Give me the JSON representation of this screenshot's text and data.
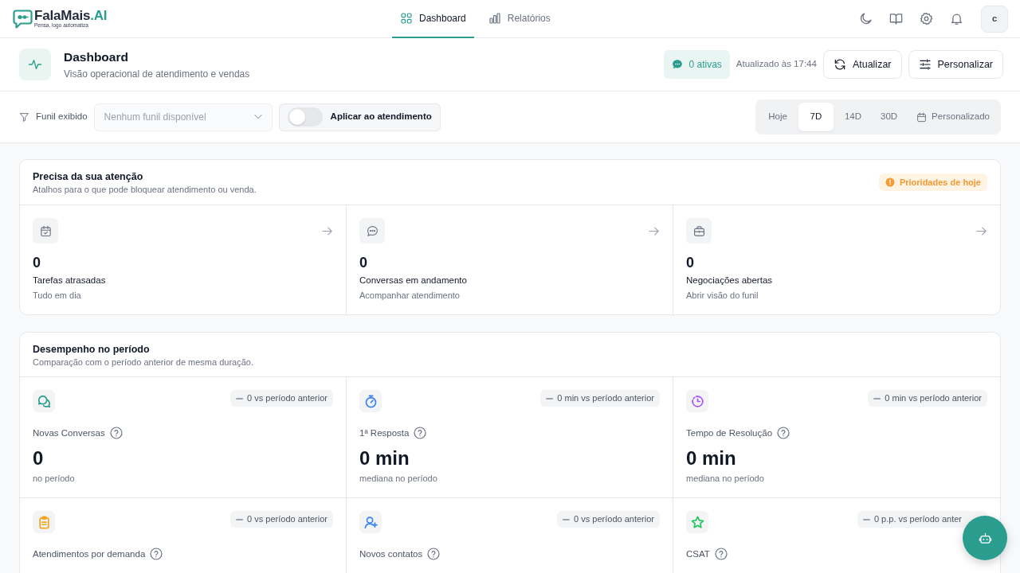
{
  "brand": {
    "name": "FalaMais",
    "suffix": ".AI",
    "tagline": "Pensa, logo automatiza"
  },
  "nav_tabs": [
    {
      "label": "Dashboard",
      "selected": true
    },
    {
      "label": "Relatórios",
      "selected": false
    }
  ],
  "user": {
    "initial": "c"
  },
  "page_header": {
    "title": "Dashboard",
    "subtitle": "Visão operacional de atendimento e vendas",
    "active_badge": "0 ativas",
    "updated": "Atualizado às 17:44",
    "buttons": [
      "Atualizar",
      "Personalizar"
    ]
  },
  "filters": {
    "funnel_label": "Funil exibido",
    "funnel_select": {
      "placeholder": "Nenhum funil disponível"
    },
    "apply_toggle": {
      "label": "Aplicar ao atendimento",
      "on": false
    },
    "periods": [
      {
        "label": "Hoje",
        "selected": false,
        "kind": "preset"
      },
      {
        "label": "7D",
        "selected": true,
        "kind": "preset"
      },
      {
        "label": "14D",
        "selected": false,
        "kind": "preset"
      },
      {
        "label": "30D",
        "selected": false,
        "kind": "preset"
      },
      {
        "label": "Personalizado",
        "selected": false,
        "kind": "custom"
      }
    ]
  },
  "attention": {
    "title": "Precisa da sua atenção",
    "subtitle": "Atalhos para o que pode bloquear atendimento ou venda.",
    "badge": "Prioridades de hoje",
    "items": [
      {
        "count": "0",
        "label": "Tarefas atrasadas",
        "hint": "Tudo em dia"
      },
      {
        "count": "0",
        "label": "Conversas em andamento",
        "hint": "Acompanhar atendimento"
      },
      {
        "count": "0",
        "label": "Negociações abertas",
        "hint": "Abrir visão do funil"
      }
    ]
  },
  "performance": {
    "title": "Desempenho no período",
    "subtitle": "Comparação com o período anterior de mesma duração.",
    "metrics": [
      {
        "label": "Novas Conversas",
        "color": "#2a9d8f",
        "delta": "0 vs período anterior",
        "value": "0",
        "caption": "no período"
      },
      {
        "label": "1ª Resposta",
        "color": "#3b82f6",
        "delta": "0 min vs período anterior",
        "value": "0 min",
        "caption": "mediana no período"
      },
      {
        "label": "Tempo de Resolução",
        "color": "#a855f7",
        "delta": "0 min vs período anterior",
        "value": "0 min",
        "caption": "mediana no período"
      },
      {
        "label": "Atendimentos por demanda",
        "color": "#f5a524",
        "delta": "0 vs período anterior"
      },
      {
        "label": "Novos contatos",
        "color": "#3b82f6",
        "delta": "0 vs período anterior"
      },
      {
        "label": "CSAT",
        "color": "#22c55e",
        "delta": "0 p.p. vs período anter"
      }
    ]
  }
}
